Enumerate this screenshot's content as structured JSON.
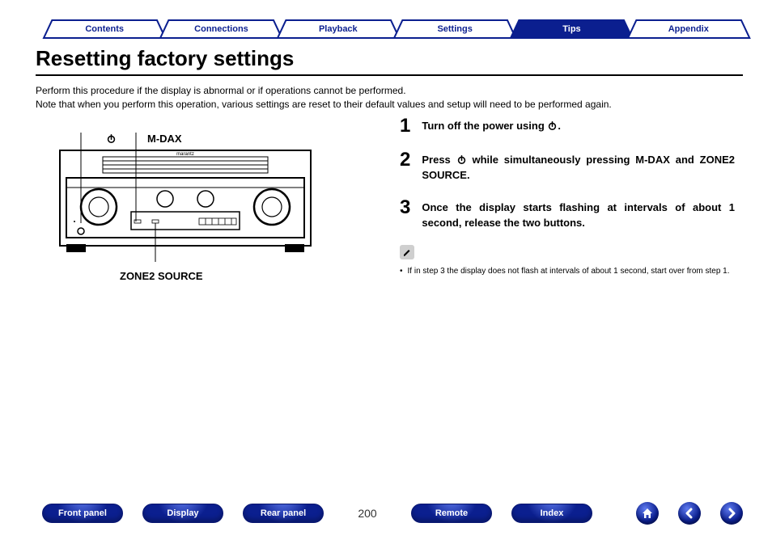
{
  "tabs": {
    "contents": "Contents",
    "connections": "Connections",
    "playback": "Playback",
    "settings": "Settings",
    "tips": "Tips",
    "appendix": "Appendix"
  },
  "title": "Resetting factory settings",
  "intro_line1": "Perform this procedure if the display is abnormal or if operations cannot be performed.",
  "intro_line2": "Note that when you perform this operation, various settings are reset to their default values and setup will need to be performed again.",
  "diagram": {
    "brand": "marantz",
    "label_mdax": "M-DAX",
    "label_zone2": "ZONE2 SOURCE"
  },
  "steps": [
    {
      "n": "1",
      "text_a": "Turn off the power using ",
      "icon": "power",
      "text_b": "."
    },
    {
      "n": "2",
      "text_a": "Press ",
      "icon": "power",
      "text_b": " while simultaneously pressing M-DAX and ZONE2 SOURCE."
    },
    {
      "n": "3",
      "text_a": "Once the display starts flashing at intervals of about 1 second, release the two buttons.",
      "icon": null,
      "text_b": ""
    }
  ],
  "note": "If in step 3 the display does not flash at intervals of about 1 second, start over from step 1.",
  "footer": {
    "front": "Front panel",
    "display": "Display",
    "rear": "Rear panel",
    "page": "200",
    "remote": "Remote",
    "index": "Index"
  }
}
